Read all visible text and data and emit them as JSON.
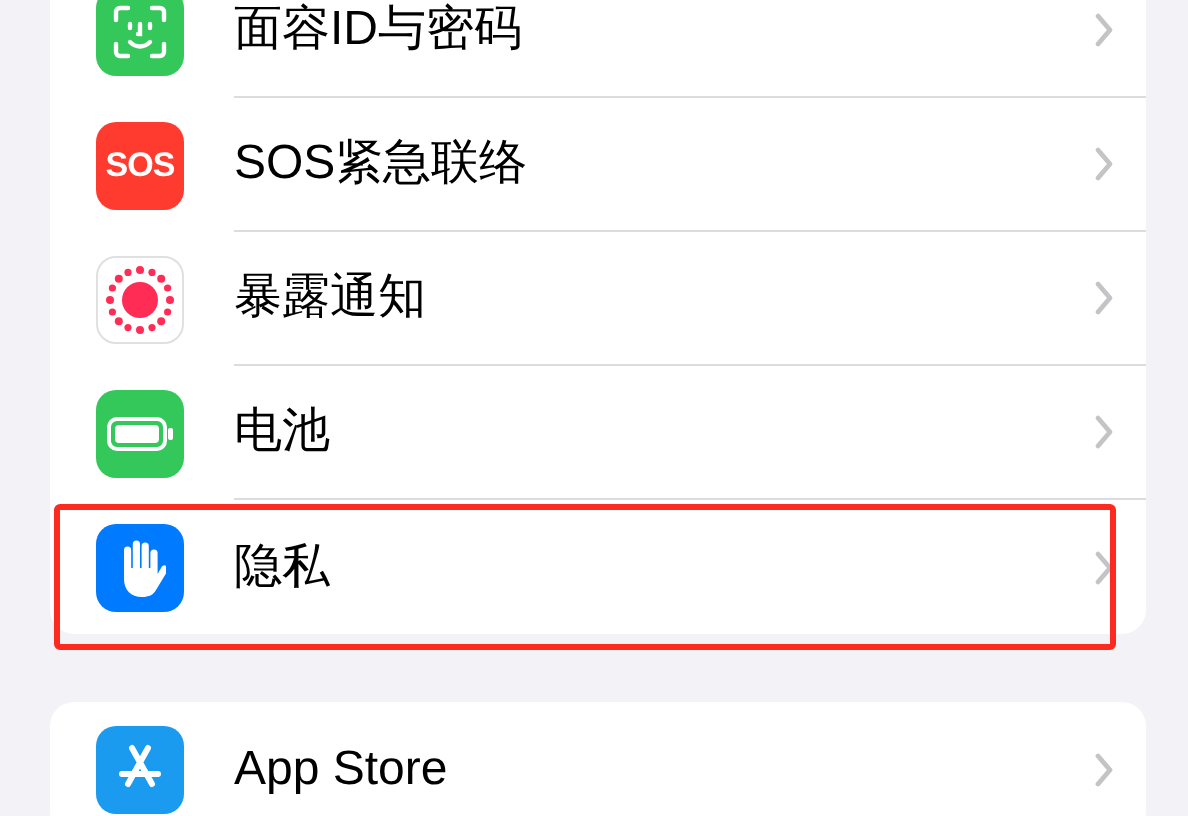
{
  "groups": [
    {
      "items": [
        {
          "kind": "face-id",
          "label": "面容ID与密码",
          "highlighted": false
        },
        {
          "kind": "sos",
          "icon_text": "SOS",
          "label": "SOS紧急联络",
          "highlighted": false
        },
        {
          "kind": "exposure",
          "label": "暴露通知",
          "highlighted": false
        },
        {
          "kind": "battery",
          "label": "电池",
          "highlighted": false
        },
        {
          "kind": "privacy",
          "label": "隐私",
          "highlighted": true
        }
      ]
    },
    {
      "items": [
        {
          "kind": "app-store",
          "label": "App Store",
          "highlighted": false
        }
      ]
    }
  ]
}
